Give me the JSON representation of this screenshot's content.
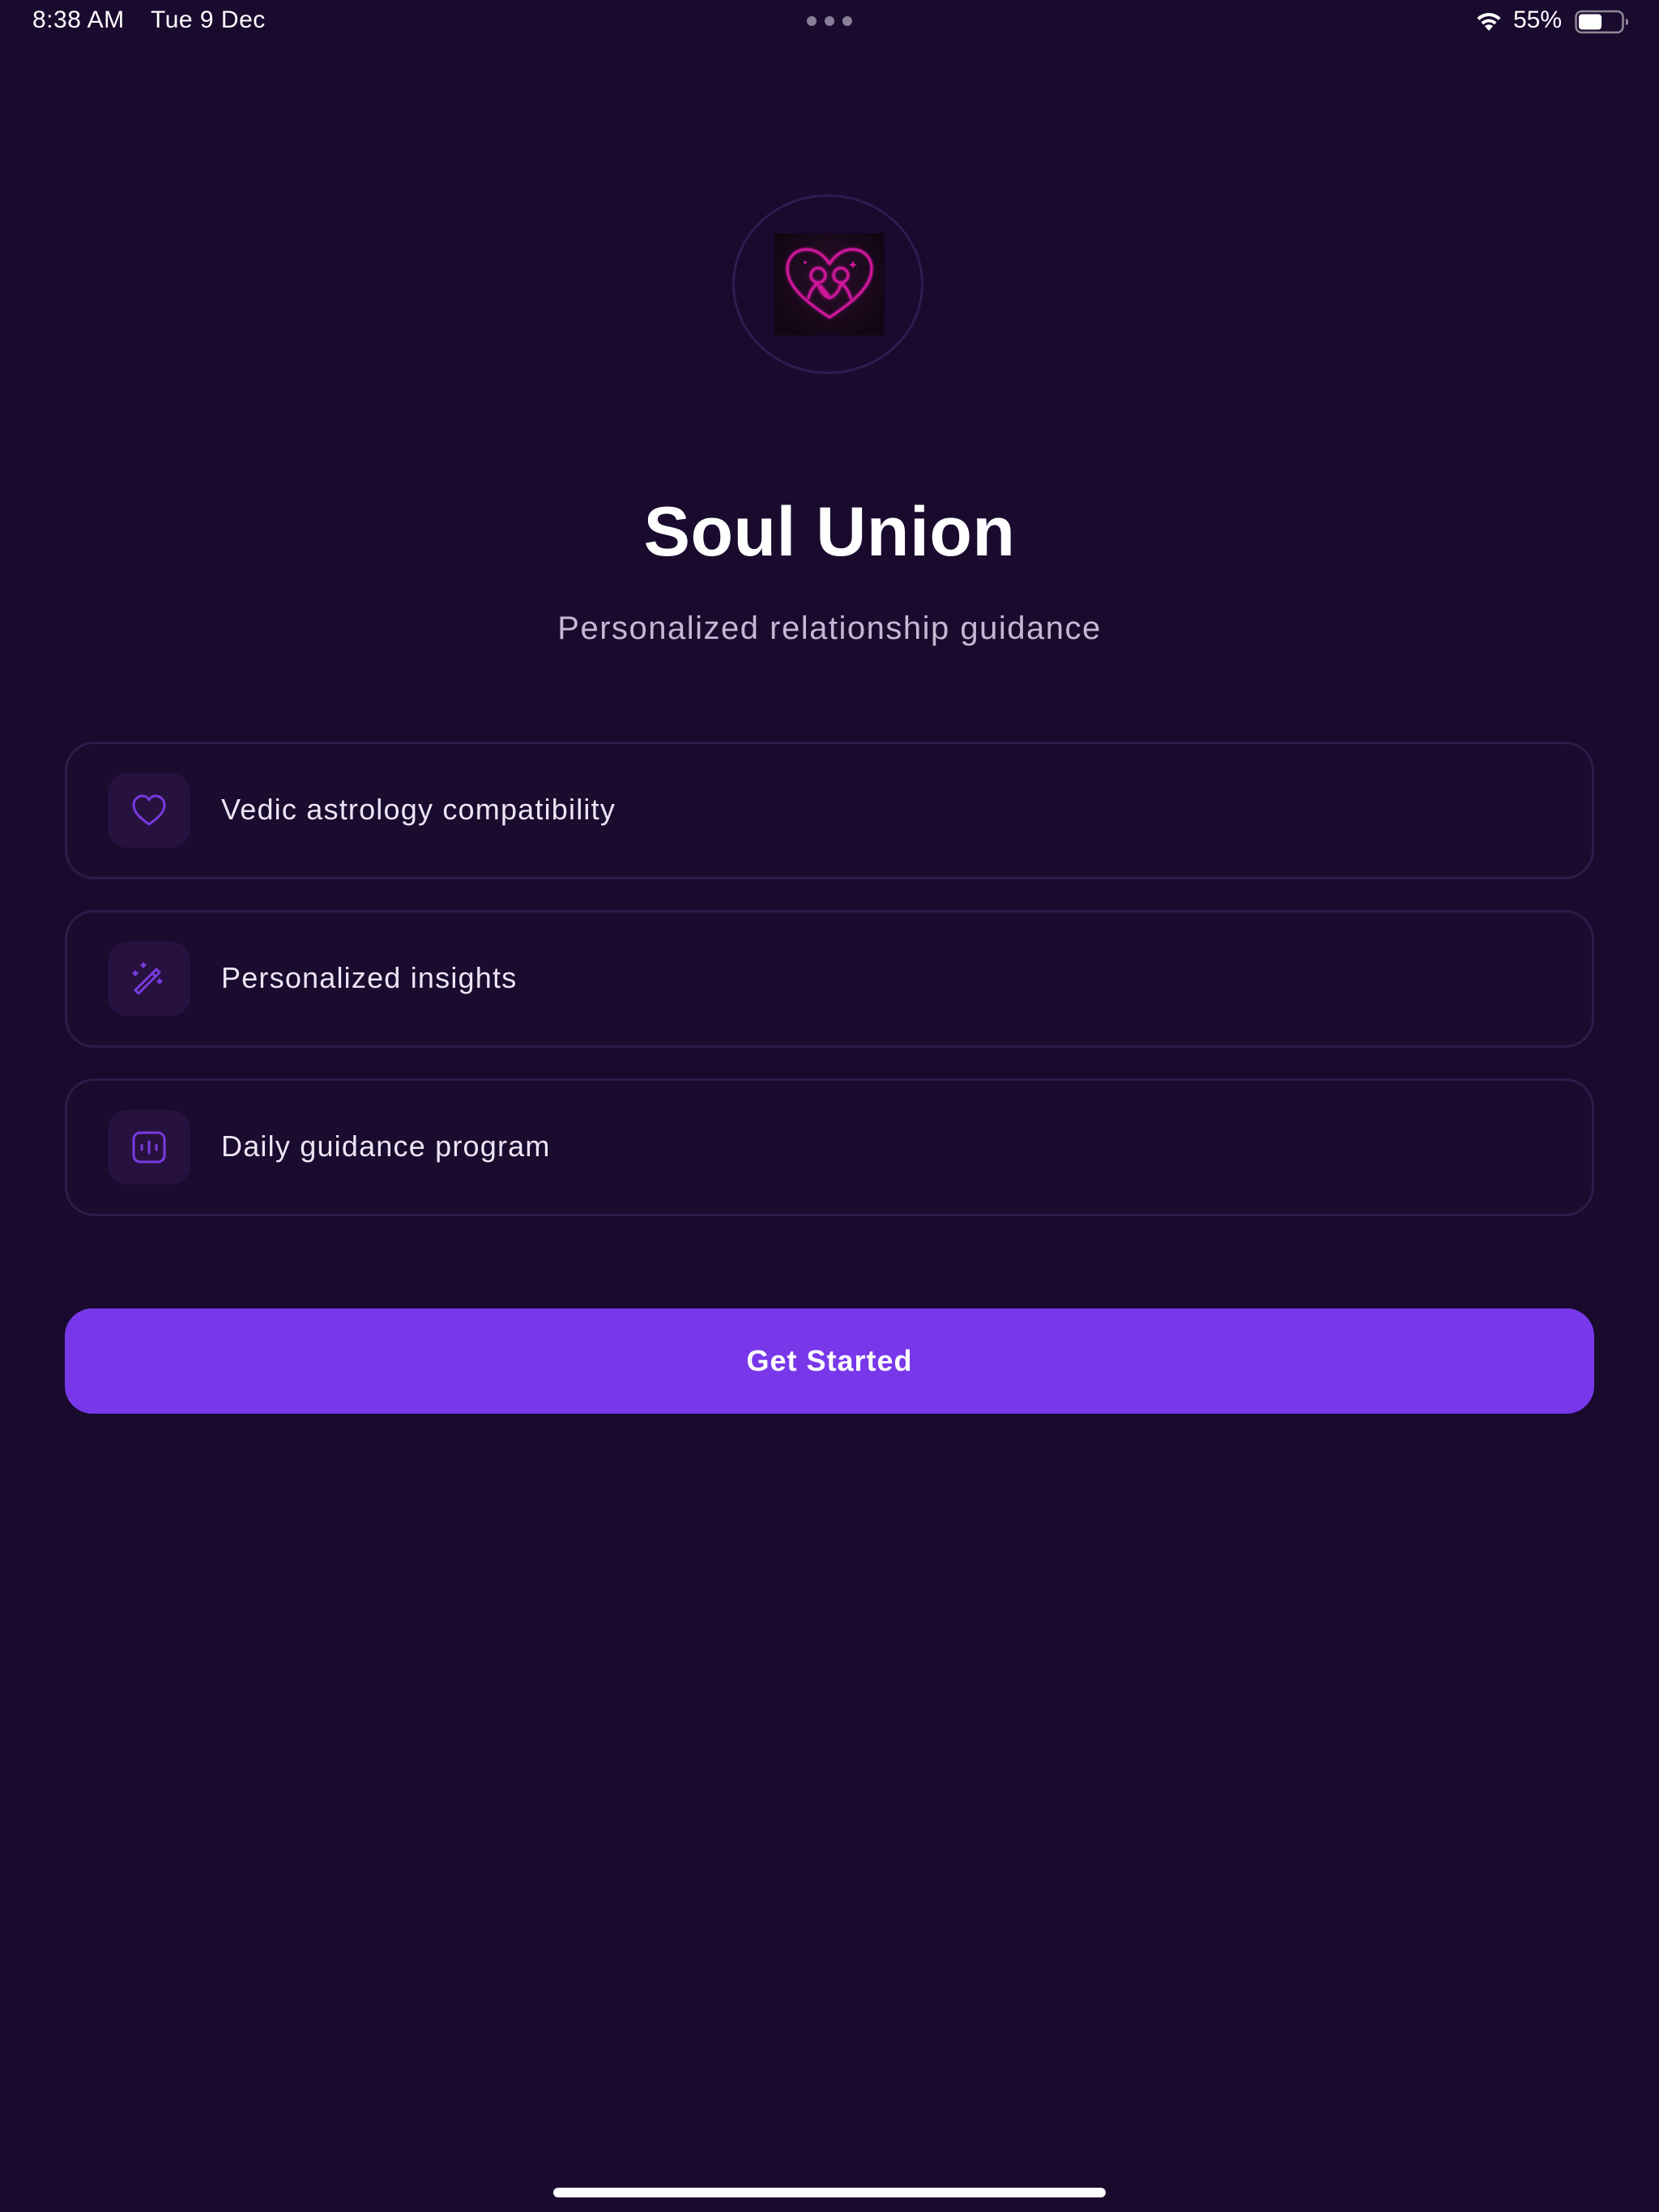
{
  "status_bar": {
    "time": "8:38 AM",
    "date": "Tue 9 Dec",
    "battery_percent": "55%",
    "battery_level": 0.55,
    "icons": [
      "wifi-icon",
      "battery-icon"
    ]
  },
  "logo": {
    "icon": "heart-couple-logo-icon"
  },
  "header": {
    "title": "Soul Union",
    "subtitle": "Personalized relationship guidance"
  },
  "features": [
    {
      "label": "Vedic astrology compatibility",
      "icon": "heart-icon"
    },
    {
      "label": "Personalized insights",
      "icon": "magic-wand-icon"
    },
    {
      "label": "Daily guidance program",
      "icon": "audio-lines-icon"
    }
  ],
  "cta": {
    "label": "Get Started"
  },
  "colors": {
    "background": "#190a2e",
    "accent": "#7838ea",
    "card_border": "#2f1a4a",
    "icon_box": "#27123f",
    "logo_pink": "#d0189c"
  }
}
